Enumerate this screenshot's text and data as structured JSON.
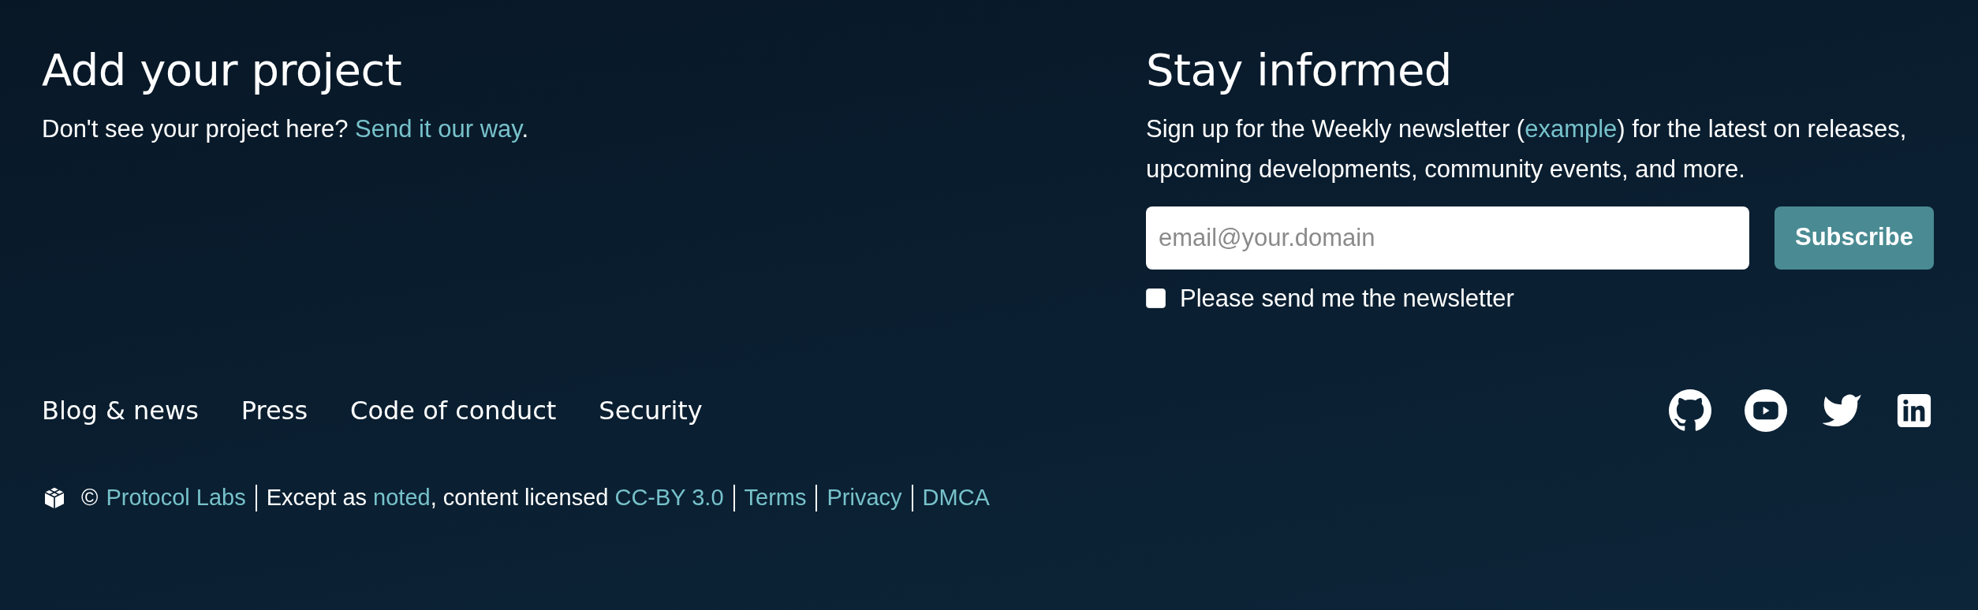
{
  "add_project": {
    "title": "Add your project",
    "text": [
      {
        "kind": "text",
        "text": "Don't see your project here? "
      },
      {
        "kind": "link",
        "text": "Send it our way"
      },
      {
        "kind": "text",
        "text": "."
      }
    ]
  },
  "newsletter": {
    "title": "Stay informed",
    "text": [
      {
        "kind": "text",
        "text": "Sign up for the Weekly newsletter ("
      },
      {
        "kind": "link",
        "text": "example"
      },
      {
        "kind": "text",
        "text": ") for the latest on releases, upcoming developments, community events, and more."
      }
    ],
    "email": {
      "placeholder": "email@your.domain"
    },
    "subscribe": "Subscribe",
    "consent": {
      "label": "Please send me the newsletter",
      "checked": false
    }
  },
  "nav_links": [
    "Blog & news",
    "Press",
    "Code of conduct",
    "Security"
  ],
  "social": [
    {
      "kind": "github"
    },
    {
      "kind": "youtube"
    },
    {
      "kind": "twitter"
    },
    {
      "kind": "linkedin"
    }
  ],
  "footer": {
    "copyright": "©",
    "owner": "Protocol Labs",
    "license": [
      {
        "kind": "text",
        "text": "Except as "
      },
      {
        "kind": "link",
        "text": "noted"
      },
      {
        "kind": "text",
        "text": ", content licensed "
      },
      {
        "kind": "link",
        "text": "CC-BY 3.0"
      }
    ],
    "links": [
      "Terms",
      "Privacy",
      "DMCA"
    ]
  }
}
